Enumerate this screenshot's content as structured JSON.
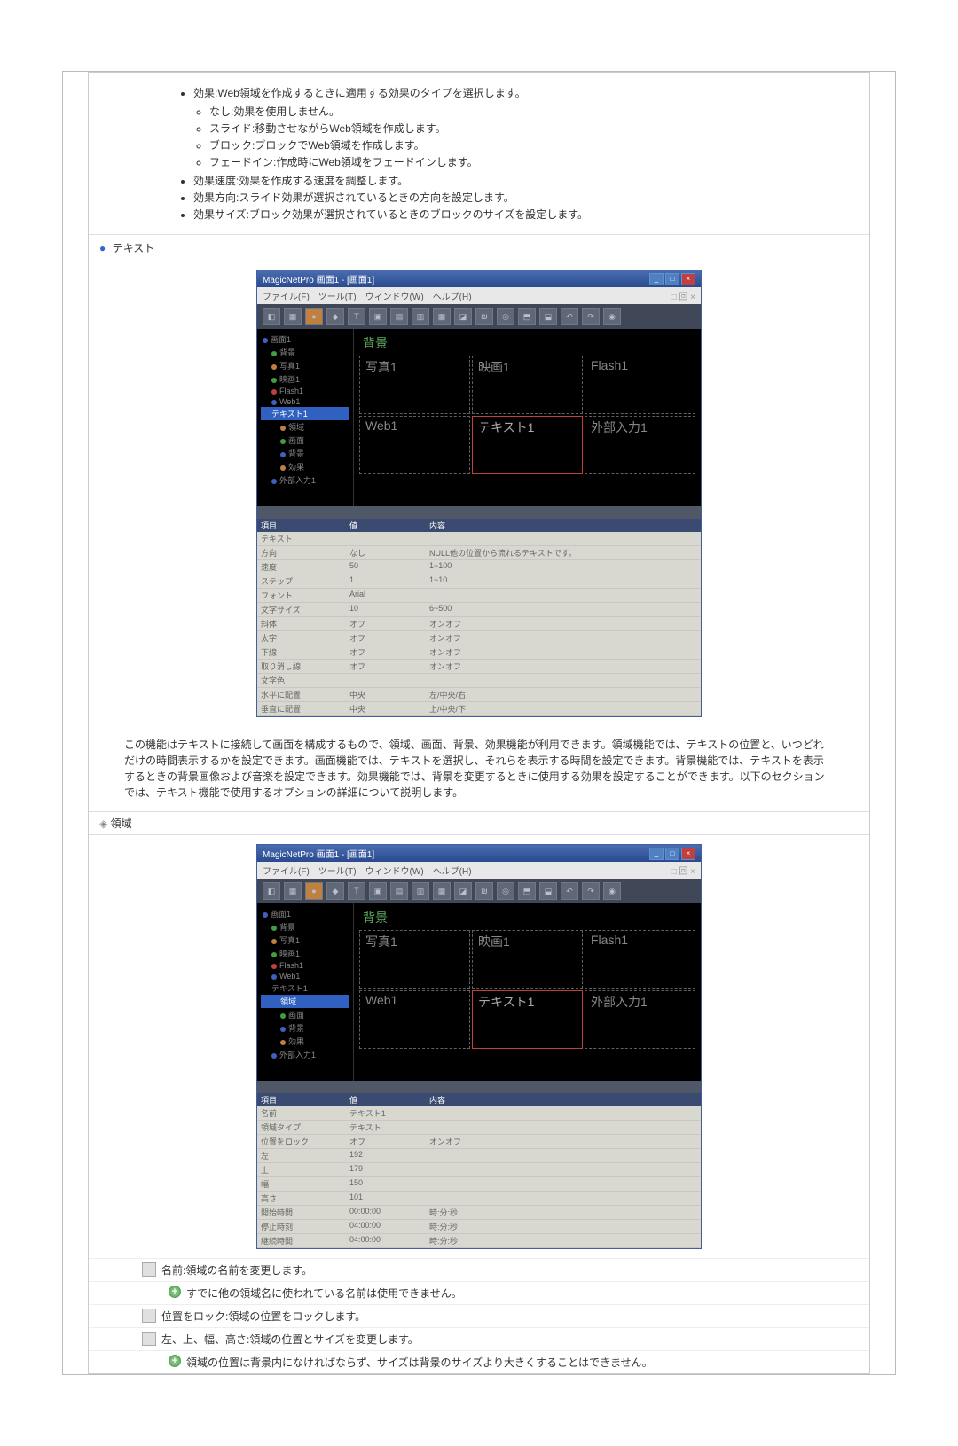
{
  "effects": {
    "title": "効果:Web領域を作成するときに適用する効果のタイプを選択します。",
    "sub1": "なし:効果を使用しません。",
    "sub2": "スライド:移動させながらWeb領域を作成します。",
    "sub3": "ブロック:ブロックでWeb領域を作成します。",
    "sub4": "フェードイン:作成時にWeb領域をフェードインします。",
    "speed": "効果速度:効果を作成する速度を調整します。",
    "direction": "効果方向:スライド効果が選択されているときの方向を設定します。",
    "size": "効果サイズ:ブロック効果が選択されているときのブロックのサイズを設定します。"
  },
  "text_section": {
    "heading": "テキスト"
  },
  "app": {
    "title": "MagicNetPro 画面1 - [画面1]",
    "menu": {
      "file": "ファイル(F)",
      "tool": "ツール(T)",
      "window": "ウィンドウ(W)",
      "help": "ヘルプ(H)",
      "right": "□ 回 ×"
    },
    "bg_label": "背景",
    "regions": {
      "r1": "写真1",
      "r2": "映画1",
      "r3": "Flash1",
      "r4": "Web1",
      "r5": "テキスト1",
      "r6": "外部入力1"
    },
    "tree": {
      "root": "画面1",
      "i1": "背景",
      "i2": "写真1",
      "i3": "映画1",
      "i4": "Flash1",
      "i5": "Web1",
      "i6": "テキスト1",
      "i6a": "領域",
      "i6b": "画面",
      "i6c": "背景",
      "i6d": "効果",
      "i7": "外部入力1"
    }
  },
  "props1_header": {
    "c1": "項目",
    "c2": "値",
    "c3": "内容"
  },
  "props1": [
    {
      "name": "テキスト",
      "val": "",
      "desc": ""
    },
    {
      "name": "方向",
      "val": "なし",
      "desc": "NULL他の位置から流れるテキストです。"
    },
    {
      "name": "速度",
      "val": "50",
      "desc": "1~100"
    },
    {
      "name": "ステップ",
      "val": "1",
      "desc": "1~10"
    },
    {
      "name": "フォント",
      "val": "Arial",
      "desc": ""
    },
    {
      "name": "文字サイズ",
      "val": "10",
      "desc": "6~500"
    },
    {
      "name": "斜体",
      "val": "オフ",
      "desc": "オンオフ"
    },
    {
      "name": "太字",
      "val": "オフ",
      "desc": "オンオフ"
    },
    {
      "name": "下線",
      "val": "オフ",
      "desc": "オンオフ"
    },
    {
      "name": "取り消し線",
      "val": "オフ",
      "desc": "オンオフ"
    },
    {
      "name": "文字色",
      "val": "",
      "desc": ""
    },
    {
      "name": "水平に配置",
      "val": "中央",
      "desc": "左/中央/右"
    },
    {
      "name": "垂直に配置",
      "val": "中央",
      "desc": "上/中央/下"
    }
  ],
  "text_desc": "この機能はテキストに接続して画面を構成するもので、領域、画面、背景、効果機能が利用できます。領域機能では、テキストの位置と、いつどれだけの時間表示するかを設定できます。画面機能では、テキストを選択し、それらを表示する時間を設定できます。背景機能では、テキストを表示するときの背景画像および音楽を設定できます。効果機能では、背景を変更するときに使用する効果を設定することができます。以下のセクションでは、テキスト機能で使用するオプションの詳細について説明します。",
  "region_section": {
    "heading": "領域"
  },
  "props2_header": {
    "c1": "項目",
    "c2": "値",
    "c3": "内容"
  },
  "props2": [
    {
      "name": "名前",
      "val": "テキスト1",
      "desc": ""
    },
    {
      "name": "領域タイプ",
      "val": "テキスト",
      "desc": ""
    },
    {
      "name": "位置をロック",
      "val": "オフ",
      "desc": "オンオフ"
    },
    {
      "name": "左",
      "val": "192",
      "desc": ""
    },
    {
      "name": "上",
      "val": "179",
      "desc": ""
    },
    {
      "name": "幅",
      "val": "150",
      "desc": ""
    },
    {
      "name": "高さ",
      "val": "101",
      "desc": ""
    },
    {
      "name": "開始時間",
      "val": "00:00:00",
      "desc": "時:分:秒"
    },
    {
      "name": "停止時刻",
      "val": "04:00:00",
      "desc": "時:分:秒"
    },
    {
      "name": "継続時間",
      "val": "04:00:00",
      "desc": "時:分:秒"
    }
  ],
  "notes": {
    "n1_title": "名前:領域の名前を変更します。",
    "n1_note": "すでに他の領域名に使われている名前は使用できません。",
    "n2_title": "位置をロック:領域の位置をロックします。",
    "n3_title": "左、上、幅、高さ:領域の位置とサイズを変更します。",
    "n3_note": "領域の位置は背景内になければならず、サイズは背景のサイズより大きくすることはできません。"
  }
}
